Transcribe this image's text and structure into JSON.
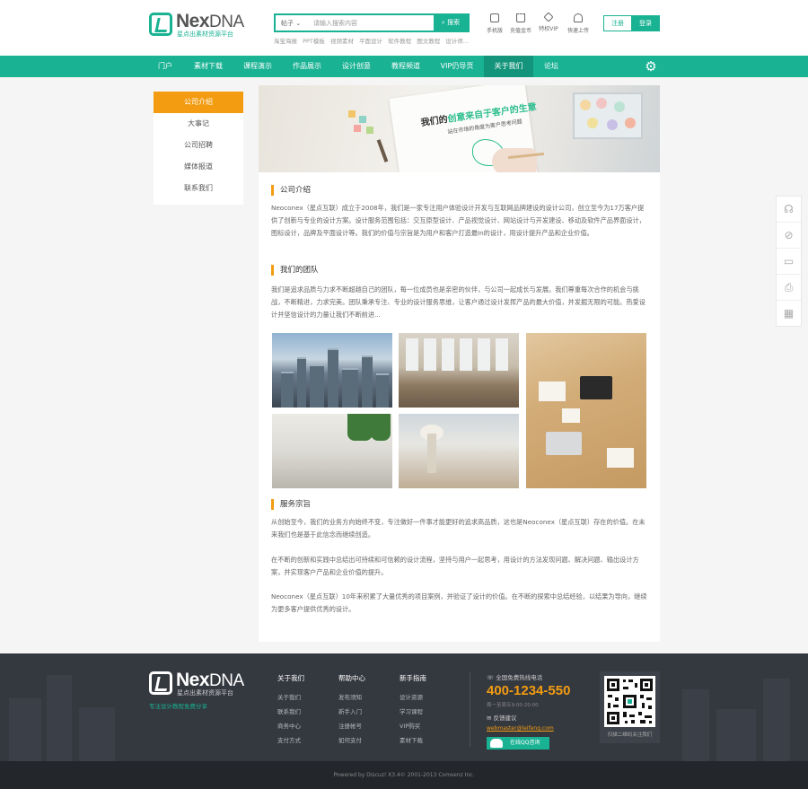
{
  "header": {
    "logo_brand": "Nex",
    "logo_brand_suffix": "DNA",
    "logo_tagline": "星点出素材资源平台",
    "search": {
      "scope": "帖子",
      "placeholder": "请输入搜索内容",
      "button": "搜索"
    },
    "hotwords": [
      "淘宝海报",
      "PPT模板",
      "视频素材",
      "平面设计",
      "软件教程",
      "图文教程",
      "设计师..."
    ],
    "quick_links": [
      {
        "label": "手机版",
        "icon": "mobile-icon"
      },
      {
        "label": "充值金币",
        "icon": "crown-icon"
      },
      {
        "label": "特权VIP",
        "icon": "diamond-icon"
      },
      {
        "label": "快速上传",
        "icon": "cloud-upload-icon"
      }
    ],
    "register": "注册",
    "login": "登录"
  },
  "nav": {
    "items": [
      "门户",
      "素材下载",
      "课程演示",
      "作品展示",
      "设计创意",
      "教程频道",
      "VIP仍导页",
      "关于我们",
      "论坛"
    ],
    "active_index": 7,
    "settings_icon": "gear-icon"
  },
  "sidebar": {
    "items": [
      "公司介绍",
      "大事记",
      "公司招聘",
      "媒体报道",
      "联系我们"
    ],
    "active_index": 0
  },
  "banner": {
    "title_prefix": "我们的",
    "title_highlight": "创意来自于客户的生意",
    "subtitle": "站在市场的角度为客户思考问题"
  },
  "sections": {
    "intro": {
      "title": "公司介绍",
      "text": "Neoconex（星点互联）成立于2008年，我们是一家专注用户体验设计开发与互联网品牌建设的设计公司，创立至今为17万客户提供了创新与专业的设计方案。设计服务范围包括：交互原型设计、产品视觉设计、网站设计与开发建设、移动及软件产品界面设计，图标设计，品牌及平面设计等。我们的价值与宗旨是为用户和客户打造最In的设计，用设计提升产品和企业价值。"
    },
    "team": {
      "title": "我们的团队",
      "text": "我们是追求品质与力求不断超越自己的团队，每一位成员也是亲密的伙伴，与公司一起成长与发展。我们尊重每次合作的机会与挑战，不断精进，力求完美。团队秉承专注、专业的设计服务思维，让客户通过设计发挥产品的最大价值，并发掘无限的可能。热爱设计并坚信设计的力量让我们不断前进..."
    },
    "service": {
      "title": "服务宗旨",
      "paragraphs": [
        "从创始至今，我们的业务方向始终不变，专注做好一件事才能更好的追求高品质，这也是Neoconex（星点互联）存在的价值。在未来我们也是基于此信念而继续创造。",
        "在不断的创新和实践中总结出可持续和可信赖的设计流程，坚持与用户一起思考，用设计的方法发现问题、解决问题、输出设计方案，并实现客户产品和企业价值的提升。",
        "Neoconex（星点互联）10年来积累了大量优秀的项目案例，并验证了设计的价值。在不断的探索中总结经验，以结果为导向，继续为更多客户提供优秀的设计。"
      ]
    }
  },
  "float_toolbar": [
    "headset-icon",
    "compass-icon",
    "inbox-icon",
    "printer-icon",
    "qrcode-icon"
  ],
  "footer": {
    "logo_brand": "Nex",
    "logo_brand_suffix": "DNA",
    "logo_tagline": "星点出素材资源平台",
    "slogan": "专注设计教程免费分享",
    "columns": [
      {
        "title": "关于我们",
        "links": [
          "关于我们",
          "联系我们",
          "商务中心",
          "支付方式"
        ]
      },
      {
        "title": "帮助中心",
        "links": [
          "发布须知",
          "新手入门",
          "注册帐号",
          "如何支付"
        ]
      },
      {
        "title": "新手指南",
        "links": [
          "设计资源",
          "学习课程",
          "VIP购买",
          "素材下载"
        ]
      }
    ],
    "hotline_label": "全国免费热线电话",
    "hotline": "400-1234-550",
    "hours": "周一至周五9:00-20:00",
    "feedback_label": "反馈建议",
    "email": "webmaster@leifeng.com",
    "qq_button": "在线QQ咨询",
    "qr_caption": "扫描二维码关注我们"
  },
  "copyright": "Powered by Discuz! X3.4© 2001-2013 Comsenz Inc."
}
